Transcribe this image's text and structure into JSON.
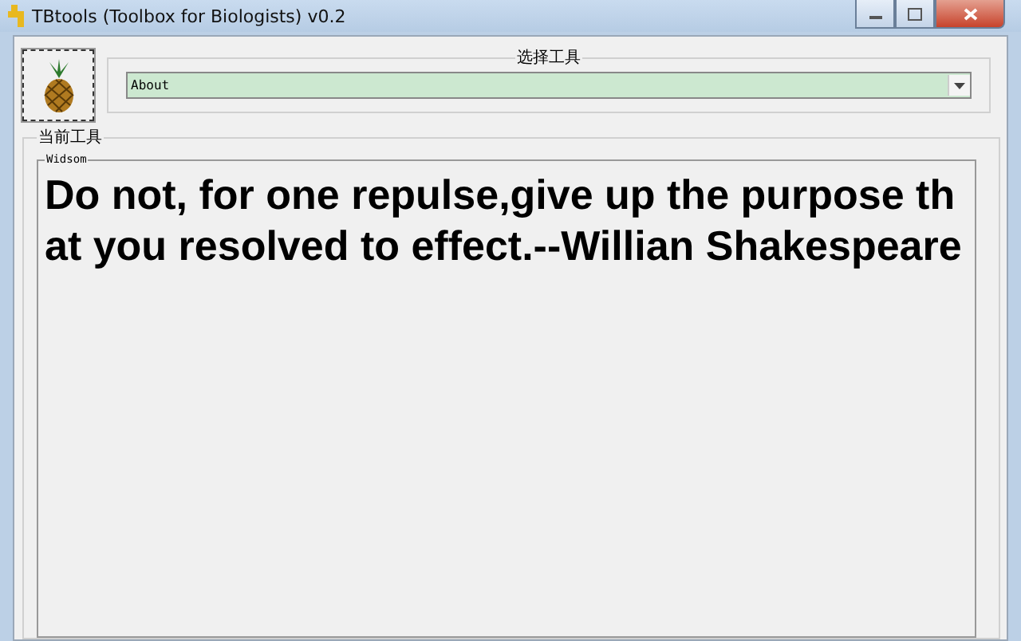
{
  "window": {
    "title": "TBtools (Toolbox for Biologists) v0.2"
  },
  "tool_selector": {
    "legend": "选择工具",
    "value": "About"
  },
  "current_tool": {
    "legend": "当前工具",
    "panel_legend": "Widsom",
    "quote": "Do not, for one repulse,give up the purpose that you resolved to effect.--Willian Shakespeare"
  }
}
